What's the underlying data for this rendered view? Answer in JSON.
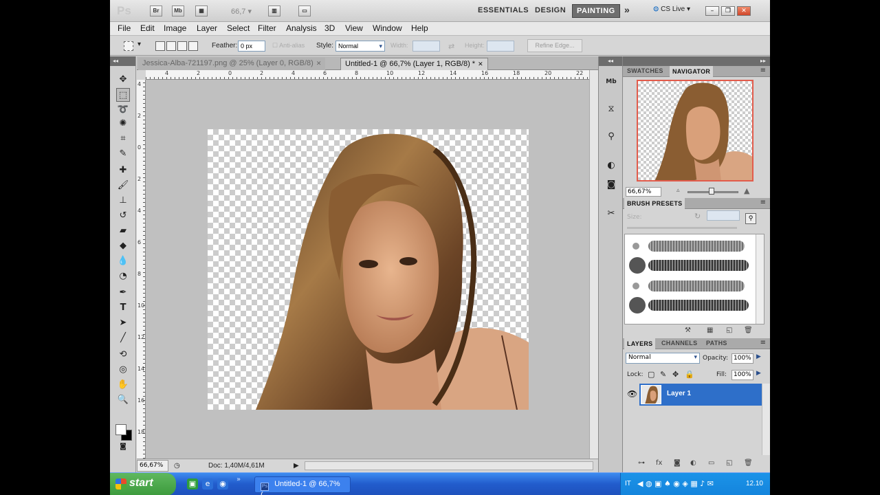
{
  "appbar": {
    "logo": "Ps",
    "bridge_button": "Br",
    "minibridge_button": "Mb",
    "zoom_level": "66,7",
    "workspaces": [
      "ESSENTIALS",
      "DESIGN",
      "PAINTING"
    ],
    "active_workspace": "PAINTING",
    "more": "»",
    "cs_live": "CS Live"
  },
  "menubar": {
    "items": [
      "File",
      "Edit",
      "Image",
      "Layer",
      "Select",
      "Filter",
      "Analysis",
      "3D",
      "View",
      "Window",
      "Help"
    ]
  },
  "options": {
    "feather_label": "Feather:",
    "feather_value": "0 px",
    "antialias_label": "Anti-alias",
    "style_label": "Style:",
    "style_value": "Normal",
    "width_label": "Width:",
    "height_label": "Height:",
    "refine_edge": "Refine Edge..."
  },
  "documents": {
    "tabs": [
      {
        "title": "Jessica-Alba-721197.png @ 25% (Layer 0, RGB/8)",
        "active": false
      },
      {
        "title": "Untitled-1 @ 66,7% (Layer 1, RGB/8) *",
        "active": true
      }
    ],
    "ruler_h": [
      "4",
      "2",
      "0",
      "2",
      "4",
      "6",
      "8",
      "10",
      "12",
      "14",
      "16",
      "18",
      "20",
      "22"
    ],
    "ruler_v": [
      "4",
      "2",
      "0",
      "2",
      "4",
      "6",
      "8",
      "10",
      "12",
      "14",
      "16",
      "18"
    ]
  },
  "status": {
    "zoom": "66,67%",
    "doc_size": "Doc: 1,40M/4,61M"
  },
  "panels": {
    "top_tabs": [
      "SWATCHES",
      "NAVIGATOR"
    ],
    "active_top_tab": "NAVIGATOR",
    "nav_zoom": "66,67%",
    "brush_tab": "BRUSH PRESETS",
    "brush_size_label": "Size:",
    "layer_tabs": [
      "LAYERS",
      "CHANNELS",
      "PATHS"
    ],
    "blend_mode": "Normal",
    "opacity_label": "Opacity:",
    "opacity_value": "100%",
    "lock_label": "Lock:",
    "fill_label": "Fill:",
    "fill_value": "100%",
    "layers": [
      {
        "name": "Layer 1",
        "selected": true,
        "visible": true
      }
    ]
  },
  "taskbar": {
    "start": "start",
    "task_title": "Untitled-1 @ 66,7% (...",
    "language": "IT",
    "clock": "12.10"
  },
  "colors": {
    "layer_selected": "#2e6fc9",
    "nav_frame": "#e25b4b",
    "taskbar": "#225ccc",
    "start_button": "#3c9a3c"
  }
}
